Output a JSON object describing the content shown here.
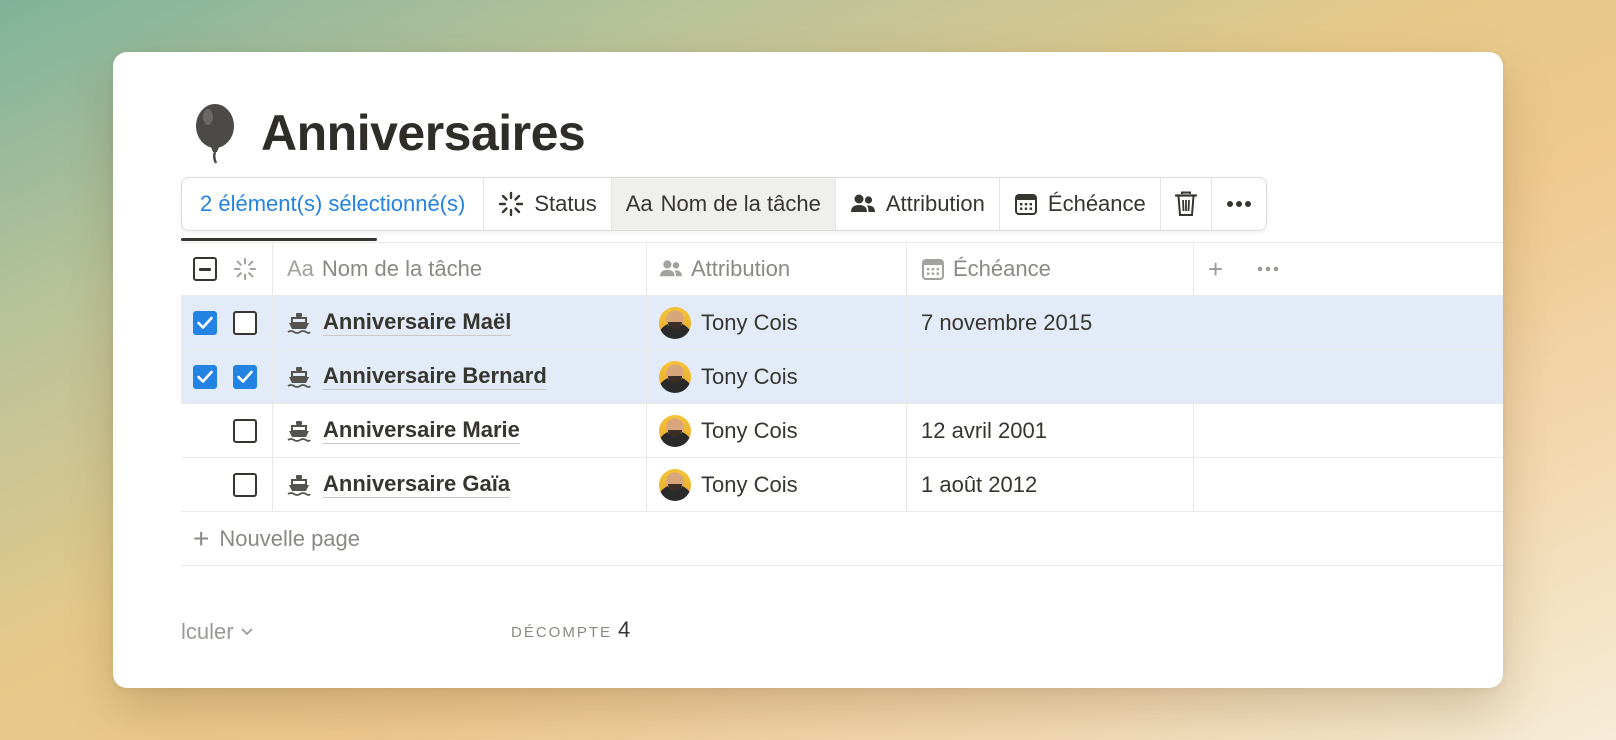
{
  "page": {
    "title": "Anniversaires",
    "icon": "balloon-icon"
  },
  "toolbar": {
    "selection_count": "2 élément(s) sélectionné(s)",
    "status_label": "Status",
    "task_name_prefix": "Aa",
    "task_name_label": "Nom de la tâche",
    "assignee_label": "Attribution",
    "due_label": "Échéance",
    "delete_icon": "trash-icon",
    "more_icon": "ellipsis-icon",
    "active_item": "Nom de la tâche"
  },
  "table": {
    "columns": {
      "task_prefix": "Aa",
      "task": "Nom de la tâche",
      "assignee": "Attribution",
      "due": "Échéance"
    },
    "rows": [
      {
        "title": "Anniversaire Maël",
        "assignee": "Tony Cois",
        "due": "7 novembre 2015",
        "selected": true,
        "done": false
      },
      {
        "title": "Anniversaire Bernard",
        "assignee": "Tony Cois",
        "due": "",
        "selected": true,
        "done": true
      },
      {
        "title": "Anniversaire Marie",
        "assignee": "Tony Cois",
        "due": "12 avril 2001",
        "selected": false,
        "done": false
      },
      {
        "title": "Anniversaire Gaïa",
        "assignee": "Tony Cois",
        "due": "1 août 2012",
        "selected": false,
        "done": false
      }
    ],
    "new_page_label": "Nouvelle page"
  },
  "footer": {
    "calculate_label": "lculer",
    "count_label": "DÉCOMPTE",
    "count_value": "4"
  },
  "colors": {
    "accent": "#2383e2",
    "selected_row": "#e2ebf7",
    "text": "#37352f",
    "muted": "#8a8984"
  }
}
